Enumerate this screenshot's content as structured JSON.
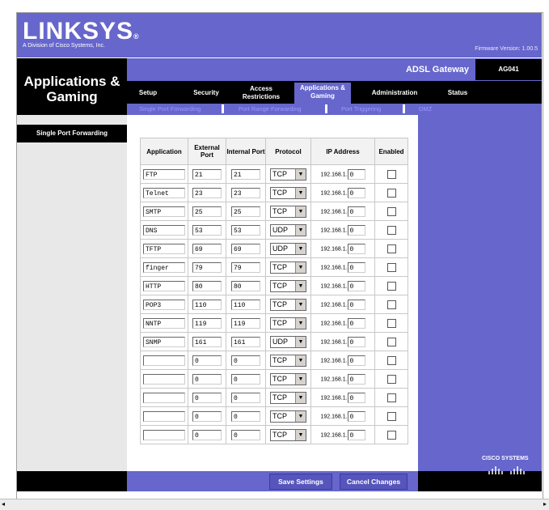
{
  "brand": {
    "logo": "LINKSYS",
    "registered": "®",
    "subtitle": "A Division of Cisco Systems, Inc.",
    "firmware": "Firmware Version: 1.00.5"
  },
  "section_title": "Applications & Gaming",
  "gateway": {
    "name": "ADSL Gateway",
    "model": "AG041"
  },
  "nav": {
    "tabs": [
      {
        "label": "Setup"
      },
      {
        "label": "Security"
      },
      {
        "label": "Access Restrictions"
      },
      {
        "label": "Applications & Gaming"
      },
      {
        "label": "Administration"
      },
      {
        "label": "Status"
      }
    ],
    "subtabs": [
      {
        "label": "Single Port Forwarding"
      },
      {
        "label": "Port Range Forwarding"
      },
      {
        "label": "Port Triggering"
      },
      {
        "label": "DMZ"
      }
    ]
  },
  "sidebar": {
    "header": "Single Port Forwarding"
  },
  "table": {
    "columns": [
      "Application",
      "External Port",
      "Internal Port",
      "Protocol",
      "IP Address",
      "Enabled"
    ],
    "ip_prefix": "192.168.1.",
    "rows": [
      {
        "app": "FTP",
        "ext": "21",
        "int": "21",
        "proto": "TCP",
        "ip": "0"
      },
      {
        "app": "Telnet",
        "ext": "23",
        "int": "23",
        "proto": "TCP",
        "ip": "0"
      },
      {
        "app": "SMTP",
        "ext": "25",
        "int": "25",
        "proto": "TCP",
        "ip": "0"
      },
      {
        "app": "DNS",
        "ext": "53",
        "int": "53",
        "proto": "UDP",
        "ip": "0"
      },
      {
        "app": "TFTP",
        "ext": "69",
        "int": "69",
        "proto": "UDP",
        "ip": "0"
      },
      {
        "app": "finger",
        "ext": "79",
        "int": "79",
        "proto": "TCP",
        "ip": "0"
      },
      {
        "app": "HTTP",
        "ext": "80",
        "int": "80",
        "proto": "TCP",
        "ip": "0"
      },
      {
        "app": "POP3",
        "ext": "110",
        "int": "110",
        "proto": "TCP",
        "ip": "0"
      },
      {
        "app": "NNTP",
        "ext": "119",
        "int": "119",
        "proto": "TCP",
        "ip": "0"
      },
      {
        "app": "SNMP",
        "ext": "161",
        "int": "161",
        "proto": "UDP",
        "ip": "0"
      },
      {
        "app": "",
        "ext": "0",
        "int": "0",
        "proto": "TCP",
        "ip": "0"
      },
      {
        "app": "",
        "ext": "0",
        "int": "0",
        "proto": "TCP",
        "ip": "0"
      },
      {
        "app": "",
        "ext": "0",
        "int": "0",
        "proto": "TCP",
        "ip": "0"
      },
      {
        "app": "",
        "ext": "0",
        "int": "0",
        "proto": "TCP",
        "ip": "0"
      },
      {
        "app": "",
        "ext": "0",
        "int": "0",
        "proto": "TCP",
        "ip": "0"
      }
    ]
  },
  "buttons": {
    "save": "Save Settings",
    "cancel": "Cancel Changes"
  },
  "footer": {
    "cisco": "CISCO SYSTEMS"
  },
  "colors": {
    "accent": "#6666cc",
    "dark": "#000000"
  }
}
